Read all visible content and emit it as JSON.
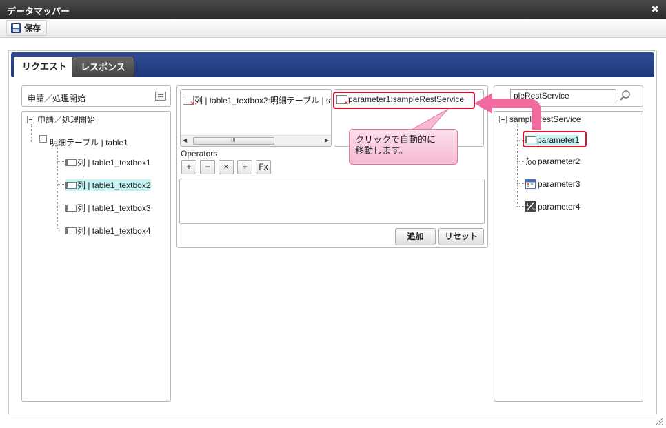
{
  "window": {
    "title": "データマッパー",
    "close_glyph": "✖"
  },
  "toolbar": {
    "save_label": "保存"
  },
  "tabs": [
    {
      "label": "リクエスト",
      "active": true
    },
    {
      "label": "レスポンス",
      "active": false
    }
  ],
  "left_panel": {
    "header": "申請／処理開始",
    "tree": {
      "root": "申請／処理開始",
      "table": "明細テーブル | table1",
      "fields": [
        {
          "label": "列 | table1_textbox1",
          "selected": false
        },
        {
          "label": "列 | table1_textbox2",
          "selected": true
        },
        {
          "label": "列 | table1_textbox3",
          "selected": false
        },
        {
          "label": "列 | table1_textbox4",
          "selected": false
        }
      ]
    }
  },
  "middle_panel": {
    "source_item": "列 | table1_textbox2:明細テーブル | tal",
    "target_item": "parameter1:sampleRestService",
    "operators_label": "Operators",
    "operators": [
      "+",
      "−",
      "×",
      "÷",
      "Fx"
    ],
    "add_button": "追加",
    "reset_button": "リセット",
    "scroll_grip": "III"
  },
  "right_panel": {
    "search_value": "pleRestService",
    "tree": {
      "root": "sampleRestService",
      "params": [
        {
          "label": "parameter1",
          "icon": "field-icon",
          "selected": true
        },
        {
          "label": "parameter2",
          "icon": "decimal-number-icon",
          "selected": false
        },
        {
          "label": "parameter3",
          "icon": "calendar-icon",
          "selected": false
        },
        {
          "label": "parameter4",
          "icon": "percent-icon",
          "selected": false
        }
      ]
    }
  },
  "callout": {
    "text_line1": "クリックで自動的に",
    "text_line2": "移動します。"
  },
  "colors": {
    "tab_bar": "#2f4c94",
    "highlight": "#d8102c",
    "callout_bg": "#f7b8d3",
    "selected_bg": "#c8f3f3",
    "arrow": "#f06aa0"
  }
}
